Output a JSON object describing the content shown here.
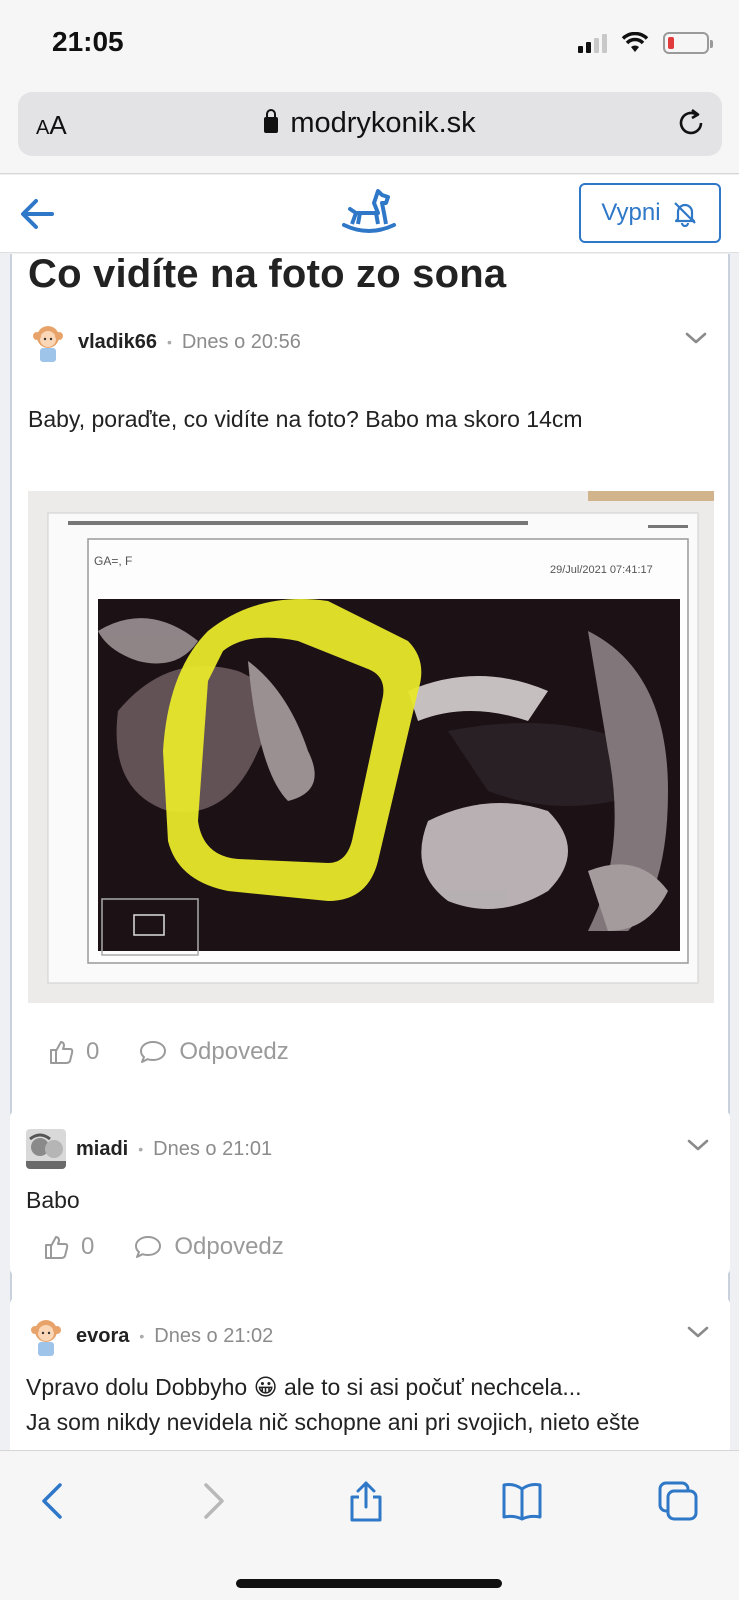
{
  "status": {
    "time": "21:05"
  },
  "browser": {
    "text_size_label_small": "A",
    "text_size_label_large": "A",
    "domain": "modrykonik.sk"
  },
  "appbar": {
    "mute_button_label": "Vypni"
  },
  "post": {
    "title": "Co vidíte na foto zo sona",
    "author": "vladik66",
    "timestamp": "Dnes o 20:56",
    "text": "Baby, poraďte, co vidíte na foto? Babo ma skoro 14cm",
    "image": {
      "patient_label": "GA=, F",
      "datetime": "29/Jul/2021 07:41:17"
    },
    "likes": "0",
    "reply_label": "Odpovedz"
  },
  "replies": [
    {
      "author": "miadi",
      "timestamp": "Dnes o 21:01",
      "text": "Babo",
      "likes": "0",
      "reply_label": "Odpovedz"
    },
    {
      "author": "evora",
      "timestamp": "Dnes o 21:02",
      "text_line1": "Vpravo dolu Dobbyho",
      "emoji": "😀",
      "text_line1_rest": "ale to si asi počuť nechcela...",
      "text_line2": "Ja som nikdy nevidela nič schopne ani pri svojich, nieto ešte"
    }
  ],
  "colors": {
    "accent": "#2f78c8",
    "highlight": "#e8e82a",
    "battery_low": "#e23b3b"
  }
}
